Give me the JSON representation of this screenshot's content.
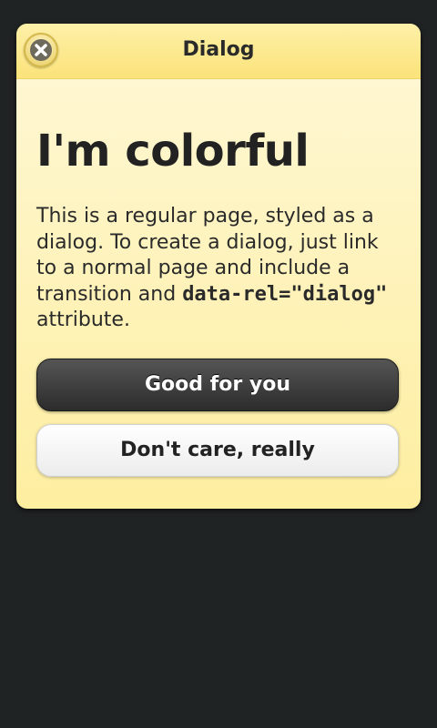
{
  "dialog": {
    "title": "Dialog",
    "close_icon": "close-icon",
    "heading": "I'm colorful",
    "body_prefix": "This is a regular page, styled as a dialog. To create a dialog, just link to a normal page and include a transition and ",
    "body_code": "data-rel=\"dialog\"",
    "body_suffix": " attribute.",
    "primary_button": "Good for you",
    "secondary_button": "Don't care, really"
  },
  "colors": {
    "background": "#202323",
    "dialog_body": "#fff6d0",
    "dialog_header": "#fbe98e",
    "primary_button": "#3a3a3a",
    "secondary_button": "#f5f5f5"
  }
}
